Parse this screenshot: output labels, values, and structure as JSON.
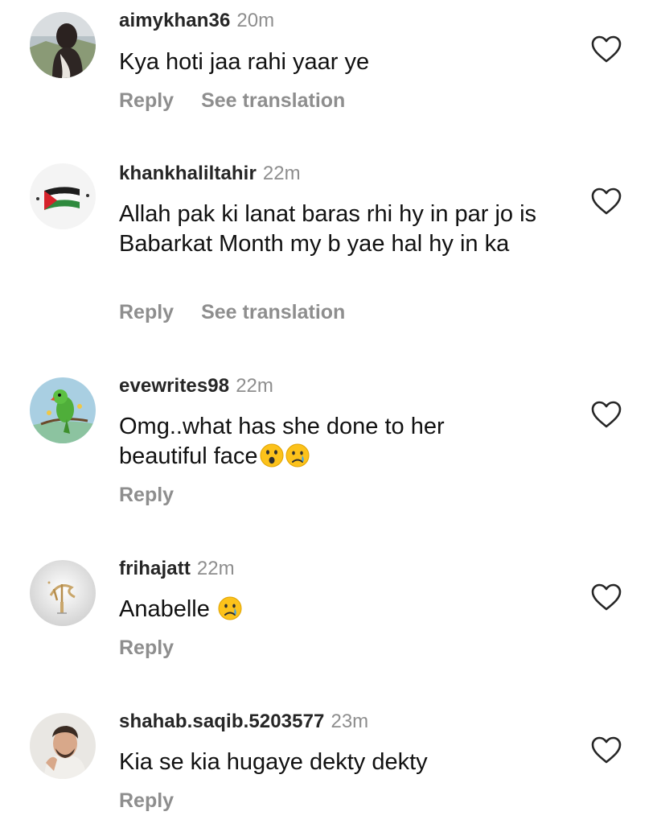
{
  "comments": [
    {
      "username": "aimykhan36",
      "time": "20m",
      "text": "Kya hoti jaa rahi yaar ye",
      "reply_label": "Reply",
      "translation_label": "See translation",
      "avatar_icon": "girl-profile-photo"
    },
    {
      "username": "khankhaliltahir",
      "time": "22m",
      "text": "Allah pak ki lanat baras rhi hy in par jo is Babarkat Month my b yae hal hy in ka",
      "reply_label": "Reply",
      "translation_label": "See translation",
      "avatar_icon": "palestine-flag"
    },
    {
      "username": "evewrites98",
      "time": "22m",
      "text": "Omg..what has she done to her beautiful face",
      "emojis": [
        "surprised-face-emoji",
        "crying-face-emoji"
      ],
      "reply_label": "Reply",
      "avatar_icon": "parrot-illustration"
    },
    {
      "username": "frihajatt",
      "time": "22m",
      "text": "Anabelle",
      "emojis": [
        "crying-face-emoji"
      ],
      "reply_label": "Reply",
      "avatar_icon": "ramadan-calligraphy"
    },
    {
      "username": "shahab.saqib.5203577",
      "time": "23m",
      "text": "Kia se kia hugaye dekty dekty",
      "reply_label": "Reply",
      "avatar_icon": "man-profile-photo"
    }
  ],
  "colors": {
    "username": "#262626",
    "secondary": "#8e8e8e",
    "text": "#111111"
  }
}
